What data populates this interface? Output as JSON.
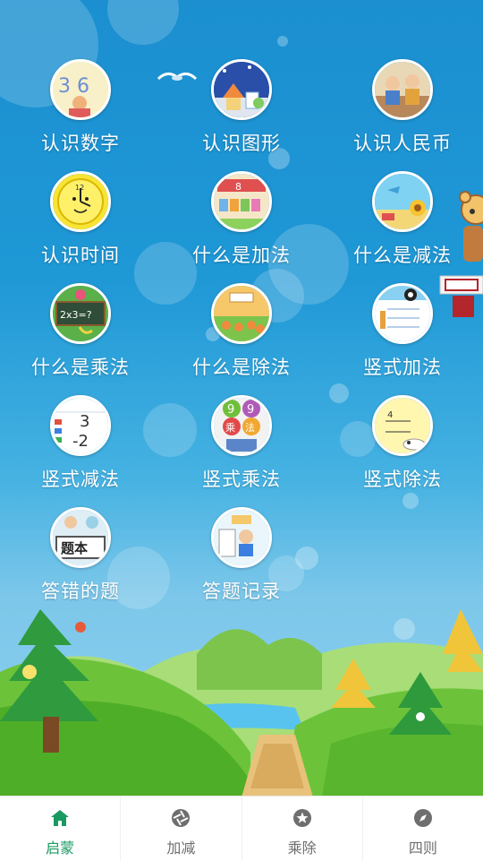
{
  "menu": {
    "items": [
      {
        "label": "认识数字",
        "icon": "numbers-icon"
      },
      {
        "label": "认识图形",
        "icon": "shapes-icon"
      },
      {
        "label": "认识人民币",
        "icon": "money-icon"
      },
      {
        "label": "认识时间",
        "icon": "clock-icon"
      },
      {
        "label": "什么是加法",
        "icon": "addition-icon"
      },
      {
        "label": "什么是减法",
        "icon": "subtraction-icon"
      },
      {
        "label": "什么是乘法",
        "icon": "multiplication-icon"
      },
      {
        "label": "什么是除法",
        "icon": "division-icon"
      },
      {
        "label": "竖式加法",
        "icon": "vertical-addition-icon"
      },
      {
        "label": "竖式减法",
        "icon": "vertical-subtraction-icon"
      },
      {
        "label": "竖式乘法",
        "icon": "vertical-multiplication-icon"
      },
      {
        "label": "竖式除法",
        "icon": "vertical-division-icon"
      },
      {
        "label": "答错的题",
        "icon": "wrong-answers-icon"
      },
      {
        "label": "答题记录",
        "icon": "answer-record-icon"
      }
    ]
  },
  "icon_text": {
    "clock": "12",
    "mult": "2x3=?",
    "sub3": "3",
    "sub2": "-2",
    "nine": "9",
    "cheng": "乘",
    "fa": "法",
    "timu": "题本",
    "add_digits": "8",
    "numbers": "3 6",
    "vdiv": "4"
  },
  "bottom_nav": {
    "tabs": [
      {
        "label": "启蒙",
        "icon": "home-icon",
        "active": true
      },
      {
        "label": "加减",
        "icon": "aperture-icon",
        "active": false
      },
      {
        "label": "乘除",
        "icon": "star-circle-icon",
        "active": false
      },
      {
        "label": "四则",
        "icon": "compass-icon",
        "active": false
      }
    ]
  },
  "colors": {
    "sky_top": "#1b8fd0",
    "active_tab": "#1a9a60",
    "inactive_tab": "#6e6e6e",
    "grass": "#6cc33a"
  }
}
